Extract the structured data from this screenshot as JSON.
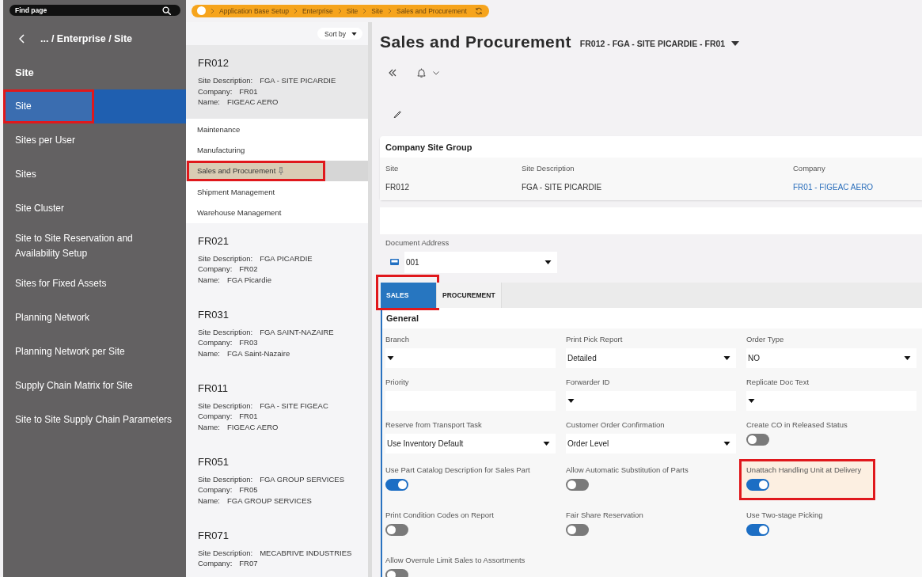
{
  "search": {
    "placeholder": "Find page"
  },
  "sidebar": {
    "path": "... / Enterprise / Site",
    "section": "Site",
    "items": [
      {
        "label": "Site",
        "selected": true,
        "annotated": true
      },
      {
        "label": "Sites per User",
        "selected": false,
        "annotated": false
      },
      {
        "label": "Sites",
        "selected": false,
        "annotated": false
      },
      {
        "label": "Site Cluster",
        "selected": false,
        "annotated": false
      },
      {
        "label": "Site to Site Reservation and Availability Setup",
        "selected": false,
        "annotated": false
      },
      {
        "label": "Sites for Fixed Assets",
        "selected": false,
        "annotated": false
      },
      {
        "label": "Planning Network",
        "selected": false,
        "annotated": false
      },
      {
        "label": "Planning Network per Site",
        "selected": false,
        "annotated": false
      },
      {
        "label": "Supply Chain Matrix for Site",
        "selected": false,
        "annotated": false
      },
      {
        "label": "Site to Site Supply Chain Parameters",
        "selected": false,
        "annotated": false
      }
    ]
  },
  "breadcrumb": {
    "items": [
      "Application Base Setup",
      "Enterprise",
      "Site",
      "Site",
      "Sales and Procurement"
    ]
  },
  "record_list": {
    "sort_label": "Sort by",
    "records": [
      {
        "code": "FR012",
        "selected": true,
        "fields": [
          {
            "label": "Site Description:",
            "value": "FGA - SITE PICARDIE"
          },
          {
            "label": "Company:",
            "value": "FR01"
          },
          {
            "label": "Name:",
            "value": "FIGEAC AERO"
          }
        ],
        "pages": [
          {
            "label": "Maintenance",
            "selected": false,
            "annotated": false,
            "pinned": false
          },
          {
            "label": "Manufacturing",
            "selected": false,
            "annotated": false,
            "pinned": false
          },
          {
            "label": "Sales and Procurement",
            "selected": true,
            "annotated": true,
            "pinned": true
          },
          {
            "label": "Shipment Management",
            "selected": false,
            "annotated": false,
            "pinned": false
          },
          {
            "label": "Warehouse Management",
            "selected": false,
            "annotated": false,
            "pinned": false
          }
        ]
      },
      {
        "code": "FR021",
        "selected": false,
        "fields": [
          {
            "label": "Site Description:",
            "value": "FGA PICARDIE"
          },
          {
            "label": "Company:",
            "value": "FR02"
          },
          {
            "label": "Name:",
            "value": "FGA Picardie"
          }
        ]
      },
      {
        "code": "FR031",
        "selected": false,
        "fields": [
          {
            "label": "Site Description:",
            "value": "FGA SAINT-NAZAIRE"
          },
          {
            "label": "Company:",
            "value": "FR03"
          },
          {
            "label": "Name:",
            "value": "FGA Saint-Nazaire"
          }
        ]
      },
      {
        "code": "FR011",
        "selected": false,
        "fields": [
          {
            "label": "Site Description:",
            "value": "FGA - SITE FIGEAC"
          },
          {
            "label": "Company:",
            "value": "FR01"
          },
          {
            "label": "Name:",
            "value": "FIGEAC AERO"
          }
        ]
      },
      {
        "code": "FR051",
        "selected": false,
        "fields": [
          {
            "label": "Site Description:",
            "value": "FGA GROUP SERVICES"
          },
          {
            "label": "Company:",
            "value": "FR05"
          },
          {
            "label": "Name:",
            "value": "FGA GROUP SERVICES"
          }
        ]
      },
      {
        "code": "FR071",
        "selected": false,
        "fields": [
          {
            "label": "Site Description:",
            "value": "MECABRIVE INDUSTRIES"
          },
          {
            "label": "Company:",
            "value": "FR07"
          }
        ]
      }
    ]
  },
  "header": {
    "title": "Sales and Procurement",
    "record": "FR012 - FGA - SITE PICARDIE - FR01"
  },
  "company_site_group": {
    "title": "Company Site Group",
    "columns": [
      {
        "label": "Site",
        "value": "FR012",
        "kind": "text"
      },
      {
        "label": "Site Description",
        "value": "FGA - SITE PICARDIE",
        "kind": "text"
      },
      {
        "label": "Company",
        "value": "FR01 - FIGEAC AERO",
        "kind": "link"
      }
    ]
  },
  "document_address": {
    "label": "Document Address",
    "value": "001"
  },
  "tabs": [
    {
      "label": "SALES",
      "selected": true,
      "annotated": true
    },
    {
      "label": "PROCUREMENT",
      "selected": false,
      "annotated": false
    }
  ],
  "general": {
    "title": "General",
    "fields": [
      {
        "label": "Branch",
        "kind": "select",
        "annotated": false
      },
      {
        "label": "Print Pick Report",
        "kind": "select",
        "value": "Detailed",
        "annotated": false
      },
      {
        "label": "Order Type",
        "kind": "select",
        "value": "NO",
        "annotated": false
      },
      {
        "label": "Priority",
        "kind": "text",
        "annotated": false
      },
      {
        "label": "Forwarder ID",
        "kind": "select",
        "annotated": false
      },
      {
        "label": "Replicate Doc Text",
        "kind": "select",
        "annotated": false
      },
      {
        "label": "Reserve from Transport Task",
        "kind": "select",
        "value": "Use Inventory Default",
        "annotated": false
      },
      {
        "label": "Customer Order Confirmation",
        "kind": "select",
        "value": "Order Level",
        "annotated": false
      },
      {
        "label": "Create CO in Released Status",
        "kind": "toggle",
        "on": false,
        "annotated": false
      },
      {
        "label": "Use Part Catalog Description for Sales Part",
        "kind": "toggle",
        "on": true,
        "annotated": false
      },
      {
        "label": "Allow Automatic Substitution of Parts",
        "kind": "toggle",
        "on": false,
        "annotated": false
      },
      {
        "label": "Unattach Handling Unit at Delivery",
        "kind": "toggle",
        "on": true,
        "annotated": true
      },
      {
        "label": "Print Condition Codes on Report",
        "kind": "toggle",
        "on": false,
        "annotated": false
      },
      {
        "label": "Fair Share Reservation",
        "kind": "toggle",
        "on": false,
        "annotated": false
      },
      {
        "label": "Use Two-stage Picking",
        "kind": "toggle",
        "on": true,
        "annotated": false
      },
      {
        "label": "Allow Overrule Limit Sales to Assortments",
        "kind": "toggle",
        "on": false,
        "annotated": false
      }
    ]
  }
}
